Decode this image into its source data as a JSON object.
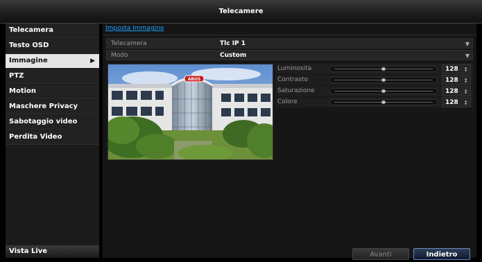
{
  "window": {
    "title": "Telecamere"
  },
  "sidebar": {
    "items": [
      {
        "label": "Telecamera",
        "active": false
      },
      {
        "label": "Testo OSD",
        "active": false
      },
      {
        "label": "Immagine",
        "active": true
      },
      {
        "label": "PTZ",
        "active": false
      },
      {
        "label": "Motion",
        "active": false
      },
      {
        "label": "Maschere Privacy",
        "active": false
      },
      {
        "label": "Sabotaggio video",
        "active": false
      },
      {
        "label": "Perdita Video",
        "active": false
      }
    ],
    "bottom_label": "Vista Live"
  },
  "main": {
    "section_title": "Imposta Immagine",
    "camera": {
      "label": "Telecamera",
      "value": "Tlc IP 1"
    },
    "mode": {
      "label": "Modo",
      "value": "Custom"
    },
    "preview_logo_text": "ABUS",
    "sliders": [
      {
        "label": "Luminosità",
        "value": "128",
        "level": 0.5
      },
      {
        "label": "Contrasto",
        "value": "128",
        "level": 0.5
      },
      {
        "label": "Saturazione",
        "value": "128",
        "level": 0.5
      },
      {
        "label": "Colore",
        "value": "128",
        "level": 0.5
      }
    ],
    "buttons": {
      "next": "Avanti",
      "back": "Indietro"
    }
  },
  "icons": {
    "chevron": "chevron-right-icon",
    "dropdown": "dropdown-arrow-icon",
    "spinner": "spinner-arrows-icon"
  },
  "colors": {
    "link": "#1aa0ff",
    "active_item": "#e6e6e6"
  }
}
